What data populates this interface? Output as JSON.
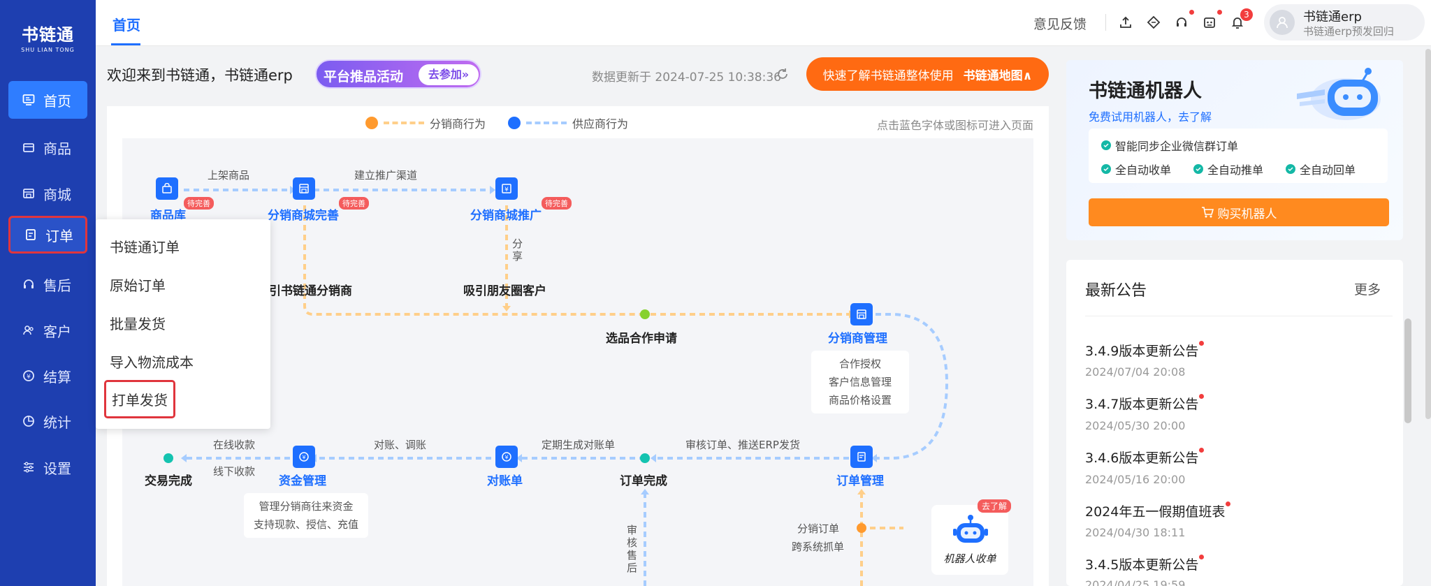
{
  "brand": {
    "name": "书链通",
    "sub": "SHU LIAN TONG"
  },
  "sidebar": {
    "items": [
      {
        "label": "首页",
        "icon": "monitor-icon"
      },
      {
        "label": "商品",
        "icon": "box-icon"
      },
      {
        "label": "商城",
        "icon": "store-icon"
      },
      {
        "label": "订单",
        "icon": "order-icon"
      },
      {
        "label": "售后",
        "icon": "headset-icon"
      },
      {
        "label": "客户",
        "icon": "users-icon"
      },
      {
        "label": "结算",
        "icon": "settle-icon"
      },
      {
        "label": "统计",
        "icon": "pie-chart-icon"
      },
      {
        "label": "设置",
        "icon": "sliders-icon"
      }
    ]
  },
  "header": {
    "tab": "首页",
    "feedback": "意见反馈",
    "notif_count": "3",
    "user_name": "书链通erp",
    "user_sub": "书链通erp预发回归"
  },
  "welcome": {
    "text": "欢迎来到书链通，书链通erp",
    "promo": "平台推品活动",
    "promo_btn": "去参加»",
    "update_time": "数据更新于 2024-07-25 10:38:36",
    "map_text": "快速了解书链通整体使用",
    "map_link": "书链通地图∧"
  },
  "flow": {
    "legend_distributor": "分销商行为",
    "legend_supplier": "供应商行为",
    "hint": "点击蓝色字体或图标可进入页面",
    "colors": {
      "distributor": "#ff9a2e",
      "supplier": "#1e6fff",
      "dash_distributor": "#ffcf8a",
      "dash_supplier": "#a6ccff"
    },
    "pending": "待完善",
    "nodes": {
      "goods_lib": "商品库",
      "mall_complete": "分销商城完善",
      "mall_promote": "分销商城推广",
      "attract_dist": "引书链通分销商",
      "attract_friends": "吸引朋友圈客户",
      "select_apply": "选品合作申请",
      "dist_manage": "分销商管理",
      "order_manage": "订单管理",
      "order_done": "订单完成",
      "statement": "对账单",
      "fund_manage": "资金管理",
      "trade_done": "交易完成",
      "robot": "机器人收单"
    },
    "edges": {
      "list_goods": "上架商品",
      "build_channel": "建立推广渠道",
      "share": "分享",
      "review_push": "审核订单、推送ERP发货",
      "gen_statement": "定期生成对账单",
      "reconcile": "对账、调账",
      "online_collect": "在线收款",
      "offline_collect": "线下收款",
      "review_aftersale": "审核售后",
      "dist_order": "分销订单",
      "cross_grab": "跨系统抓单"
    },
    "cards": {
      "dist_manage": [
        "合作授权",
        "客户信息管理",
        "商品价格设置"
      ],
      "fund_manage": [
        "管理分销商往来资金",
        "支持现款、授信、充值"
      ]
    },
    "robot_tag": "去了解"
  },
  "dropdown": {
    "items": [
      "书链通订单",
      "原始订单",
      "批量发货",
      "导入物流成本",
      "打单发货"
    ]
  },
  "robot_panel": {
    "title": "书链通机器人",
    "sub": "免费试用机器人，去了解",
    "features": [
      "智能同步企业微信群订单",
      "全自动收单",
      "全自动推单",
      "全自动回单"
    ],
    "buy": "购买机器人"
  },
  "notices": {
    "title": "最新公告",
    "more": "更多",
    "items": [
      {
        "title": "3.4.9版本更新公告",
        "date": "2024/07/04 20:08"
      },
      {
        "title": "3.4.7版本更新公告",
        "date": "2024/05/30 20:00"
      },
      {
        "title": "3.4.6版本更新公告",
        "date": "2024/05/16 20:00"
      },
      {
        "title": "2024年五一假期值班表",
        "date": "2024/04/30 18:11"
      },
      {
        "title": "3.4.5版本更新公告",
        "date": "2024/04/25 19:59"
      }
    ]
  }
}
